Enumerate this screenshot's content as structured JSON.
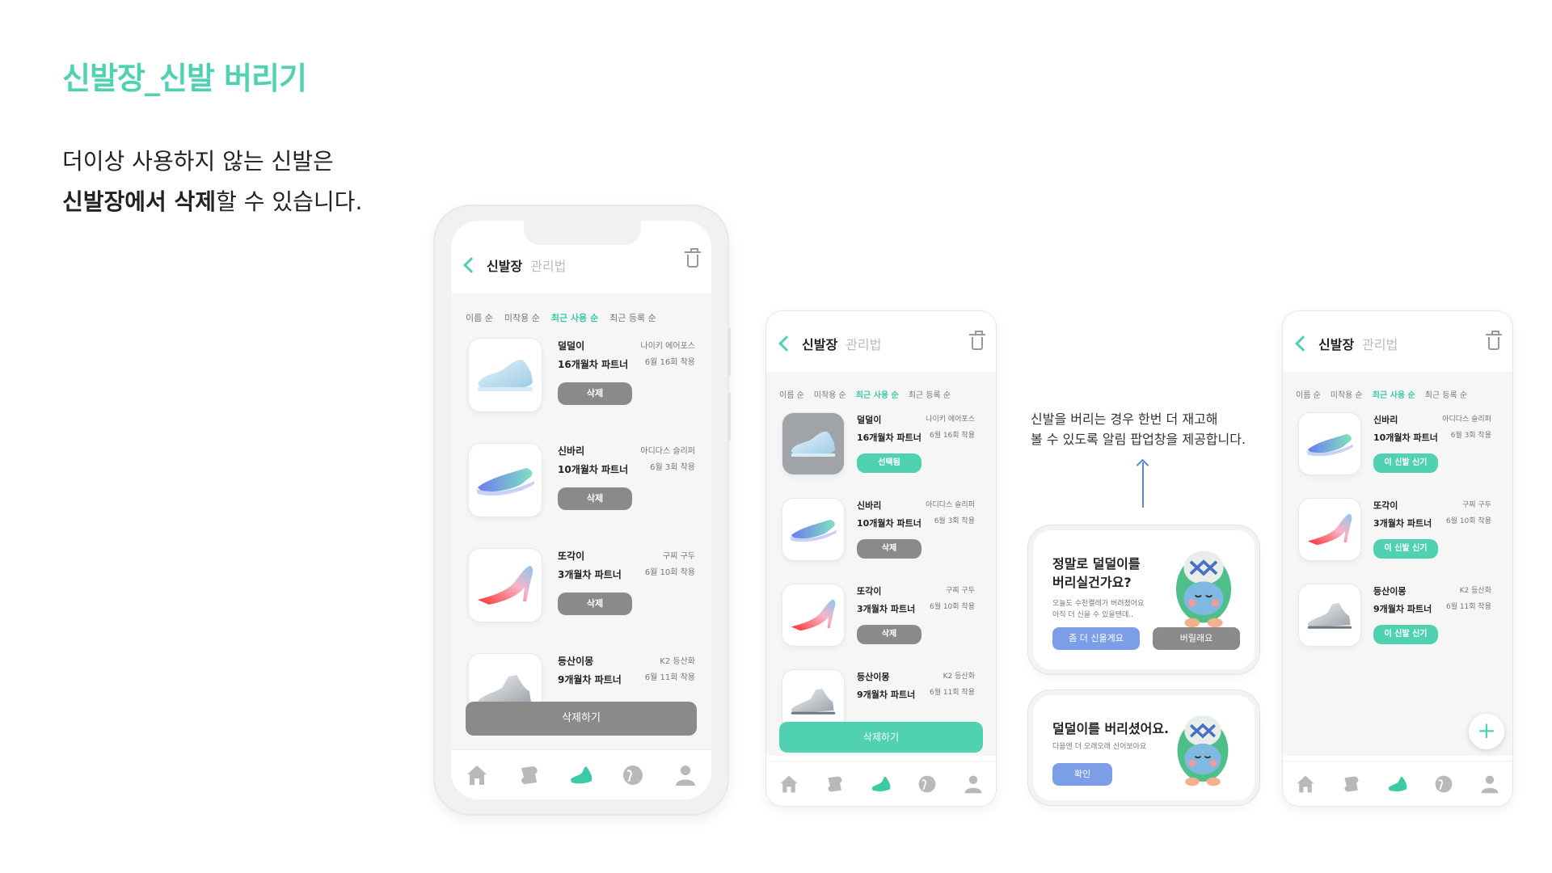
{
  "page": {
    "title": "신발장_신발 버리기",
    "desc_line1": "더이상 사용하지 않는 신발은",
    "desc_bold": "신발장에서 삭제",
    "desc_rest": "할 수 있습니다."
  },
  "header": {
    "title": "신발장",
    "subtitle": "관리법"
  },
  "sort": [
    "이름 순",
    "미착용 순",
    "최근 사용 순",
    "최근 등록 순"
  ],
  "shoes": [
    {
      "nick": "덜덜이",
      "partner": "16개월차 파트너",
      "brand": "나이키 에어포스",
      "wear": "6월 16회 착용"
    },
    {
      "nick": "신바리",
      "partner": "10개월차 파트너",
      "brand": "아디다스 슬리퍼",
      "wear": "6월 3회 착용"
    },
    {
      "nick": "또각이",
      "partner": "3개월차 파트너",
      "brand": "구찌 구두",
      "wear": "6월 10회 착용"
    },
    {
      "nick": "등산이몽",
      "partner": "9개월차 파트너",
      "brand": "K2 등산화",
      "wear": "6월 11회 착용"
    }
  ],
  "buttons": {
    "delete": "삭제",
    "selected": "선택됨",
    "delete_all": "삭제하기",
    "wear_new": "이 신발 신기"
  },
  "note": {
    "line1": "신발을 버리는 경우 한번 더 재고해",
    "line2": "볼 수 있도록 알림 팝업창을 제공합니다."
  },
  "popup1": {
    "title1": "정말로 덜덜이를",
    "title2": "버리실건가요?",
    "text1": "오늘도 수천켤레가 버려졌어요",
    "text2": "아직 더 신을 수 있을텐데..",
    "btn_keep": "좀 더 신을게요",
    "btn_throw": "버릴래요"
  },
  "popup2": {
    "title": "덜덜이를 버리셨어요.",
    "text": "다음엔 더 오래오래 신어보아요",
    "btn_ok": "확인"
  },
  "colors": {
    "accent": "#4fd1b2",
    "gray_btn": "#8a8a8a",
    "blue_btn": "#7b9ee6"
  },
  "fab": "+"
}
